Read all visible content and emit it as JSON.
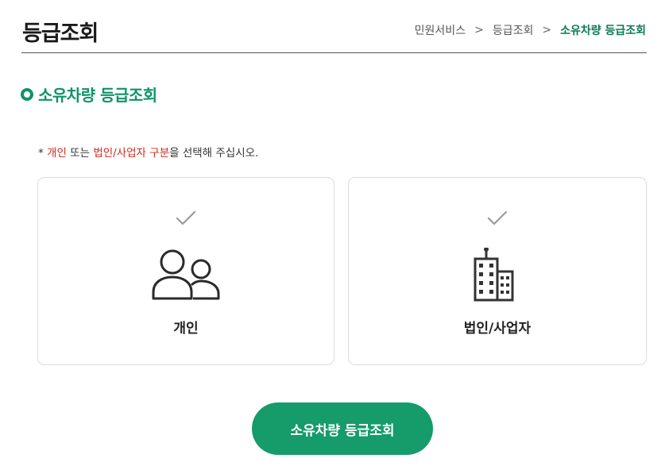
{
  "header": {
    "title": "등급조회",
    "breadcrumb": [
      "민원서비스",
      "등급조회",
      "소유차량 등급조회"
    ],
    "breadcrumb_separator": ">"
  },
  "section": {
    "title": "소유차량 등급조회"
  },
  "notice": {
    "prefix": "* ",
    "highlight1": "개인",
    "text1": " 또는 ",
    "highlight2": "법인/사업자 구분",
    "text2": "을 선택해 주십시오."
  },
  "options": [
    {
      "label": "개인",
      "icon": "people-icon",
      "checked_icon": "check-icon"
    },
    {
      "label": "법인/사업자",
      "icon": "building-icon",
      "checked_icon": "check-icon"
    }
  ],
  "submit_label": "소유차량 등급조회",
  "colors": {
    "accent": "#0f9466",
    "button": "#169b6b",
    "breadcrumb_current": "#0b7a57",
    "notice_highlight": "#d02c1d"
  }
}
